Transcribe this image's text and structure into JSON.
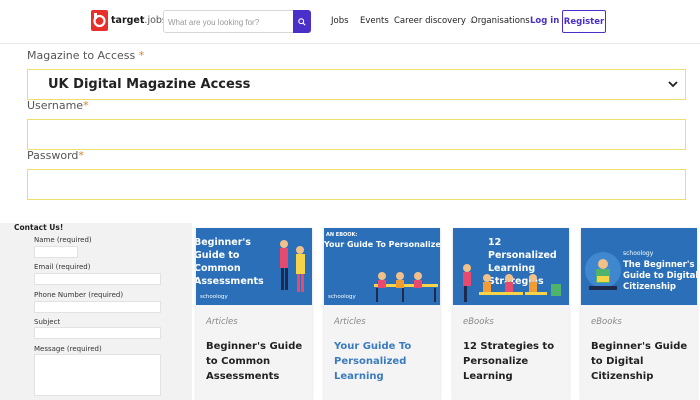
{
  "header": {
    "logo_text_bold": "target",
    "logo_text_light": "jobs",
    "search_placeholder": "What are you looking for?",
    "nav": [
      "Jobs",
      "Events",
      "Career discovery",
      "Organisations"
    ],
    "login": "Log in",
    "register": "Register"
  },
  "form": {
    "magazine_label": "Magazine to Access ",
    "magazine_value": "UK Digital Magazine Access",
    "username_label": "Username",
    "password_label": "Password",
    "required_mark": "*"
  },
  "contact": {
    "title": "Contact Us!",
    "fields": [
      "Name (required)",
      "Email (required)",
      "Phone Number (required)",
      "Subject",
      "Message (required)"
    ]
  },
  "cards": [
    {
      "image_text": "Beginner's Guide to Common Assessments",
      "category": "Articles",
      "title": "Beginner's Guide to Common Assessments",
      "title_color": "#222222"
    },
    {
      "image_text": "Your Guide To Personalized Learning",
      "image_kicker": "AN EBOOK:",
      "category": "Articles",
      "title": "Your Guide To Personalized Learning",
      "title_color": "#3a7bbf"
    },
    {
      "image_text": "12 Personalized Learning Strategies",
      "category": "eBooks",
      "title": "12 Strategies to Personalize Learning",
      "title_color": "#222222"
    },
    {
      "image_text": "The Beginner's Guide to Digital Citizenship",
      "category": "eBooks",
      "title": "Beginner's Guide to Digital Citizenship",
      "title_color": "#222222"
    }
  ],
  "brand_name": "schoology",
  "colors": {
    "accent": "#4a2fc8",
    "field_border": "#f0de6a",
    "required": "#d9822b",
    "card_image": "#2a6fb8"
  }
}
